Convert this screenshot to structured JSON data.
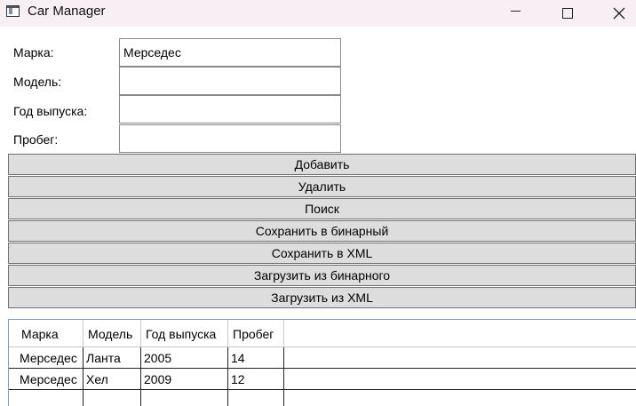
{
  "window": {
    "title": "Car Manager",
    "icon": "app-window-icon",
    "controls": [
      "minimize-icon",
      "maximize-icon",
      "close-icon"
    ]
  },
  "form": {
    "brand_label": "Марка:",
    "brand_value": "Мерседес",
    "model_label": "Модель:",
    "model_value": "",
    "year_label": "Год выпуска:",
    "year_value": "",
    "mileage_label": "Пробег:",
    "mileage_value": ""
  },
  "buttons": {
    "add": "Добавить",
    "delete": "Удалить",
    "search": "Поиск",
    "save_binary": "Сохранить в бинарный",
    "save_xml": "Сохранить в XML",
    "load_binary": "Загрузить из бинарного",
    "load_xml": "Загрузить из XML"
  },
  "table": {
    "columns": [
      "Марка",
      "Модель",
      "Год выпуска",
      "Пробег"
    ],
    "rows": [
      [
        "Мерседес",
        "Ланта",
        "2005",
        "14"
      ],
      [
        "Мерседес",
        "Хел",
        "2009",
        "12"
      ]
    ]
  },
  "colors": {
    "titlebar": "#f7eff3",
    "button_bg": "#dddddd",
    "button_border": "#707070",
    "grid_border": "#7a9cc4"
  }
}
